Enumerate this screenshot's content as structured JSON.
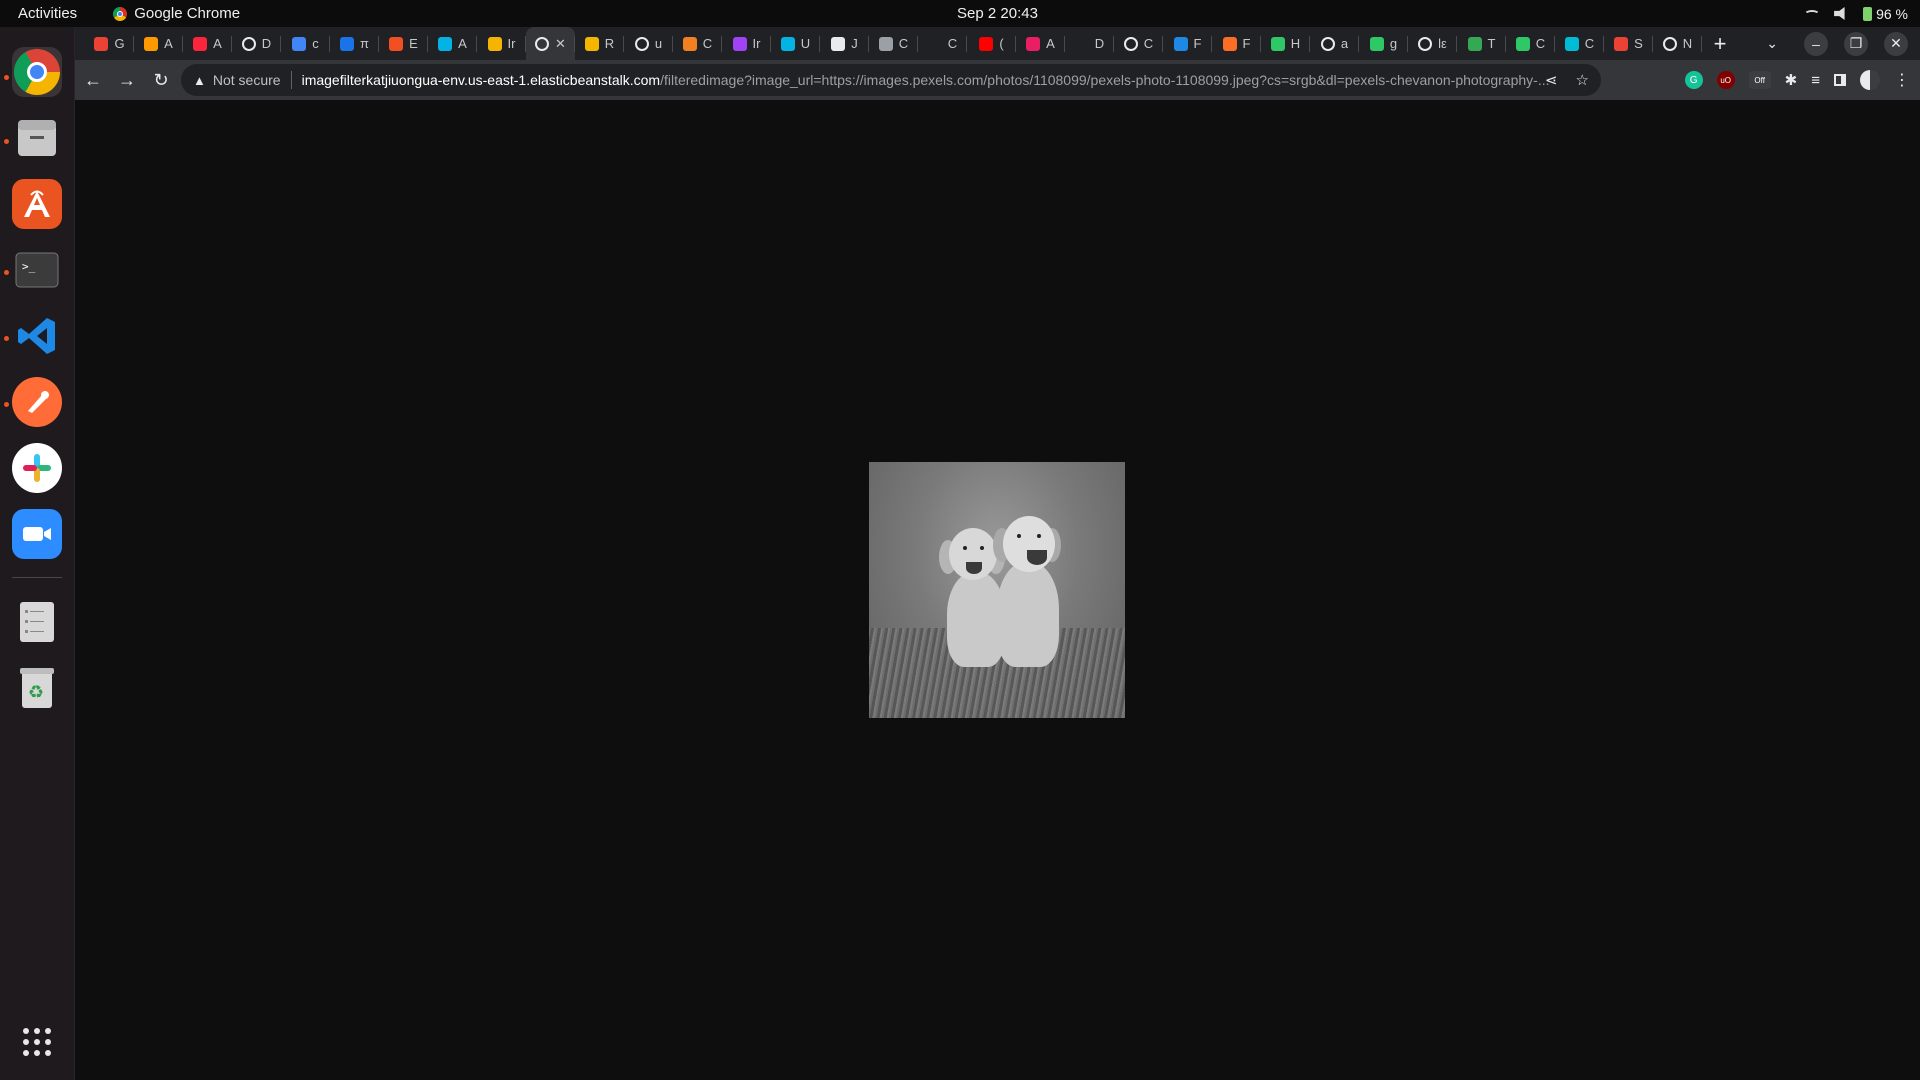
{
  "topbar": {
    "activities": "Activities",
    "app_name": "Google Chrome",
    "datetime": "Sep 2  20:43",
    "battery": "96 %"
  },
  "dock": {
    "apps": [
      "chrome",
      "files",
      "app-center",
      "terminal",
      "vscode",
      "postman",
      "slack",
      "zoom",
      "file-manager",
      "trash",
      "show-apps"
    ]
  },
  "tabs": [
    {
      "letter": "G",
      "icon": "gmail-icon",
      "color": "#ea4335"
    },
    {
      "letter": "A",
      "icon": "aws-icon",
      "color": "#ff9900"
    },
    {
      "letter": "A",
      "icon": "music-icon",
      "color": "#fa243c"
    },
    {
      "letter": "D",
      "icon": "globe-icon",
      "color": "#e8eaed"
    },
    {
      "letter": "c",
      "icon": "dots-icon",
      "color": "#4285f4"
    },
    {
      "letter": "π",
      "icon": "ring-icon",
      "color": "#1a73e8"
    },
    {
      "letter": "E",
      "icon": "microsoft-icon",
      "color": "#f25022"
    },
    {
      "letter": "A",
      "icon": "udacity-icon",
      "color": "#02b3e4"
    },
    {
      "letter": "Ir",
      "icon": "box-icon",
      "color": "#f4b400"
    },
    {
      "letter": "✕",
      "icon": "globe-icon",
      "color": "#e8eaed",
      "active": true
    },
    {
      "letter": "R",
      "icon": "box-icon",
      "color": "#f4b400"
    },
    {
      "letter": "u",
      "icon": "globe-icon",
      "color": "#e8eaed"
    },
    {
      "letter": "C",
      "icon": "cloud-icon",
      "color": "#f38020"
    },
    {
      "letter": "Ir",
      "icon": "puzzle-icon",
      "color": "#a142f4"
    },
    {
      "letter": "U",
      "icon": "udacity-icon",
      "color": "#02b3e4"
    },
    {
      "letter": "J",
      "icon": "spark-icon",
      "color": "#e8eaed"
    },
    {
      "letter": "C",
      "icon": "square-icon",
      "color": "#9aa0a6"
    },
    {
      "letter": "C",
      "icon": "circle-icon",
      "color": "#202124"
    },
    {
      "letter": "(",
      "icon": "youtube-icon",
      "color": "#ff0000"
    },
    {
      "letter": "A",
      "icon": "record-icon",
      "color": "#e91e63"
    },
    {
      "letter": "D",
      "icon": "circle-icon",
      "color": "#202124"
    },
    {
      "letter": "C",
      "icon": "github-icon",
      "color": "#e8eaed"
    },
    {
      "letter": "F",
      "icon": "play-icon",
      "color": "#1e88e5"
    },
    {
      "letter": "F",
      "icon": "gitlab-icon",
      "color": "#fc6d26"
    },
    {
      "letter": "H",
      "icon": "hackerrank-icon",
      "color": "#2ec866"
    },
    {
      "letter": "a",
      "icon": "globe-icon",
      "color": "#e8eaed"
    },
    {
      "letter": "g",
      "icon": "hackerrank-icon",
      "color": "#2ec866"
    },
    {
      "letter": "lε",
      "icon": "globe-icon",
      "color": "#e8eaed"
    },
    {
      "letter": "T",
      "icon": "gear-icon",
      "color": "#34a853"
    },
    {
      "letter": "C",
      "icon": "hackerrank-icon",
      "color": "#2ec866"
    },
    {
      "letter": "C",
      "icon": "d-icon",
      "color": "#00bcd4"
    },
    {
      "letter": "S",
      "icon": "puzzle-icon",
      "color": "#ea4335"
    },
    {
      "letter": "N",
      "icon": "chrome-icon",
      "color": "#e8eaed"
    }
  ],
  "toolbar": {
    "security_label": "Not secure",
    "url_host": "imagefilterkatjiuongua-env.us-east-1.elasticbeanstalk.com",
    "url_path": "/filteredimage?image_url=https://images.pexels.com/photos/1108099/pexels-photo-1108099.jpeg?cs=srgb&dl=pexels-chevanon-photography-..."
  },
  "extensions": {
    "ublock_off_label": "Off"
  },
  "content": {
    "image_alt": "grayscale photo of two golden retriever puppies sitting on grass"
  }
}
